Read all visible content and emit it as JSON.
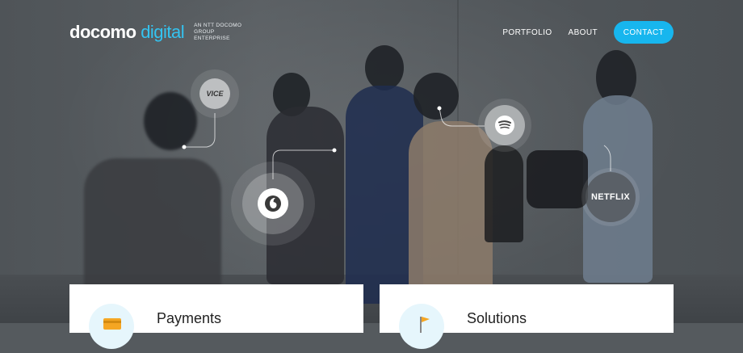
{
  "header": {
    "logo_main": "docomo",
    "logo_accent": "digital",
    "tagline": "AN NTT DOCOMO GROUP ENTERPRISE",
    "nav": [
      {
        "label": "PORTFOLIO"
      },
      {
        "label": "ABOUT"
      }
    ],
    "contact_label": "CONTACT"
  },
  "bubbles": {
    "vice": "VICE",
    "netflix": "NETFLIX"
  },
  "cards": [
    {
      "title": "Payments"
    },
    {
      "title": "Solutions"
    }
  ],
  "colors": {
    "accent": "#17b6ee",
    "logo_accent": "#34c3f0"
  }
}
